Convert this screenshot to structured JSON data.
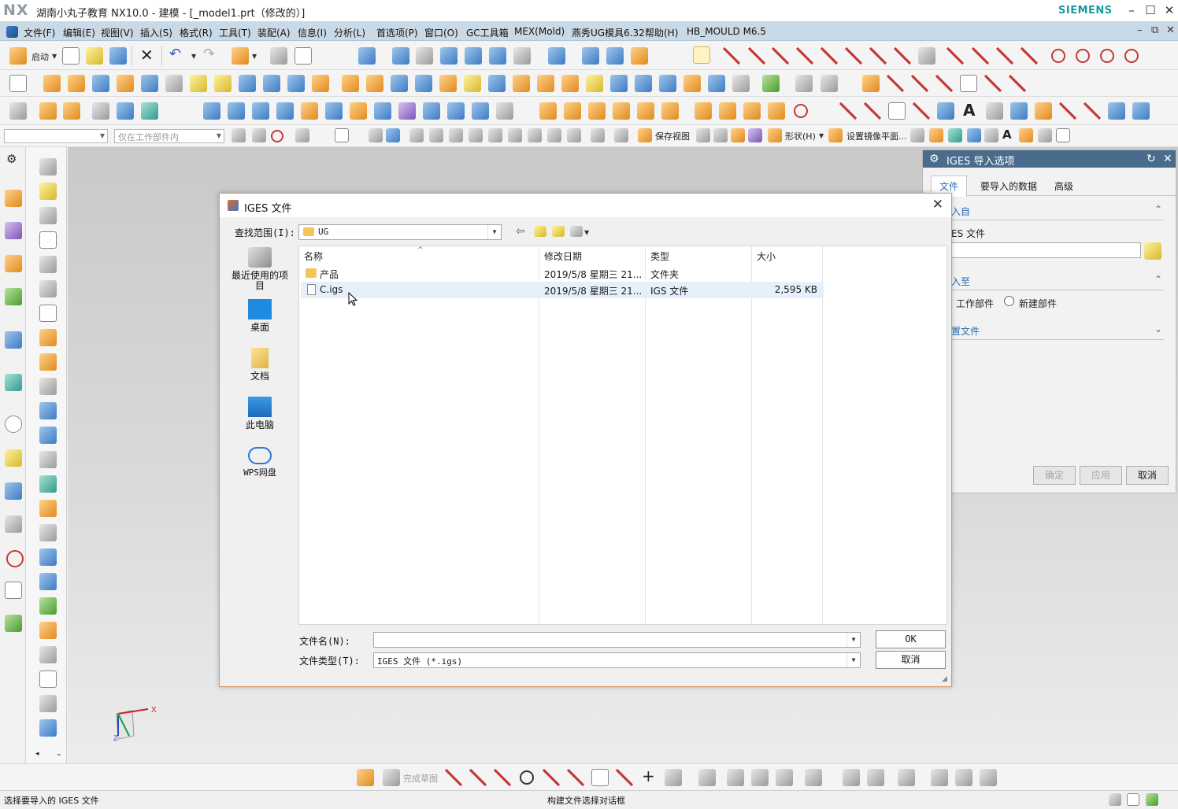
{
  "window": {
    "logo": "NX",
    "title": "湖南小丸子教育 NX10.0 - 建模 - [_model1.prt（修改的）]",
    "brand": "SIEMENS",
    "minimize": "–",
    "maximize": "☐",
    "close": "✕"
  },
  "menu": {
    "items": [
      "文件(F)",
      "编辑(E)",
      "视图(V)",
      "插入(S)",
      "格式(R)",
      "工具(T)",
      "装配(A)",
      "信息(I)",
      "分析(L)",
      "首选项(P)",
      "窗口(O)",
      "GC工具箱",
      "MEX(Mold)",
      "燕秀UG模具6.32",
      "帮助(H)",
      "HB_MOULD M6.5"
    ],
    "mdi_min": "–",
    "mdi_restore": "⧉",
    "mdi_close": "✕"
  },
  "toolbar": {
    "start_label": "启动",
    "filter_combo": "",
    "scope_combo": "仅在工作部件内",
    "save_view": "保存视图",
    "shape_menu": "形状(H)",
    "mirror_plane": "设置镜像平面..."
  },
  "iges_panel": {
    "title": "IGES 导入选项",
    "tabs": [
      "文件",
      "要导入的数据",
      "高级"
    ],
    "section_import_from": "入自",
    "iges_file_label": "ES 文件",
    "section_import_to": "入至",
    "opt_work_part": "工作部件",
    "opt_new_part": "新建部件",
    "section_settings": "置文件",
    "btn_ok": "确定",
    "btn_apply": "应用",
    "btn_cancel": "取消"
  },
  "file_dialog": {
    "title": "IGES 文件",
    "look_in_label": "查找范围(I):",
    "look_in_value": "UG",
    "places": [
      "最近使用的项目",
      "桌面",
      "文档",
      "此电脑",
      "WPS网盘"
    ],
    "columns": [
      "名称",
      "修改日期",
      "类型",
      "大小"
    ],
    "rows": [
      {
        "name": "产品",
        "date": "2019/5/8 星期三 21...",
        "type": "文件夹",
        "size": ""
      },
      {
        "name": "C.igs",
        "date": "2019/5/8 星期三 21...",
        "type": "IGS 文件",
        "size": "2,595 KB"
      }
    ],
    "filename_label": "文件名(N):",
    "filename_value": "",
    "filetype_label": "文件类型(T):",
    "filetype_value": "IGES 文件 (*.igs)",
    "ok": "OK",
    "cancel": "取消"
  },
  "bottom_toolbar": {
    "finish_sketch": "完成草图"
  },
  "status": {
    "left": "选择要导入的 IGES 文件",
    "center": "构建文件选择对话框"
  },
  "colors": {
    "menubar": "#c9d9e6",
    "panel_header": "#4a6c8c",
    "accent_blue": "#2a6db5",
    "siemens_teal": "#1a9aa0",
    "dialog_border": "#d49a68"
  }
}
